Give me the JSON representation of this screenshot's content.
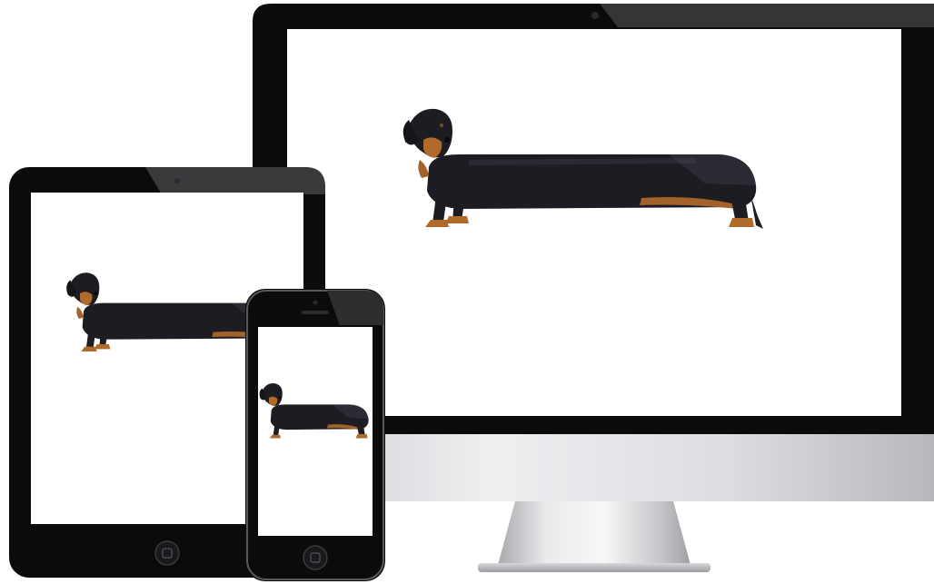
{
  "scene": {
    "subject": "dachshund-stretched",
    "devices": [
      "desktop-monitor",
      "tablet",
      "smartphone"
    ]
  },
  "colors": {
    "bezel": "#0b0b0c",
    "screen": "#ffffff",
    "dog_black": "#1d1c22",
    "dog_tan": "#b06a2a",
    "silver": "#d8d9dc"
  }
}
